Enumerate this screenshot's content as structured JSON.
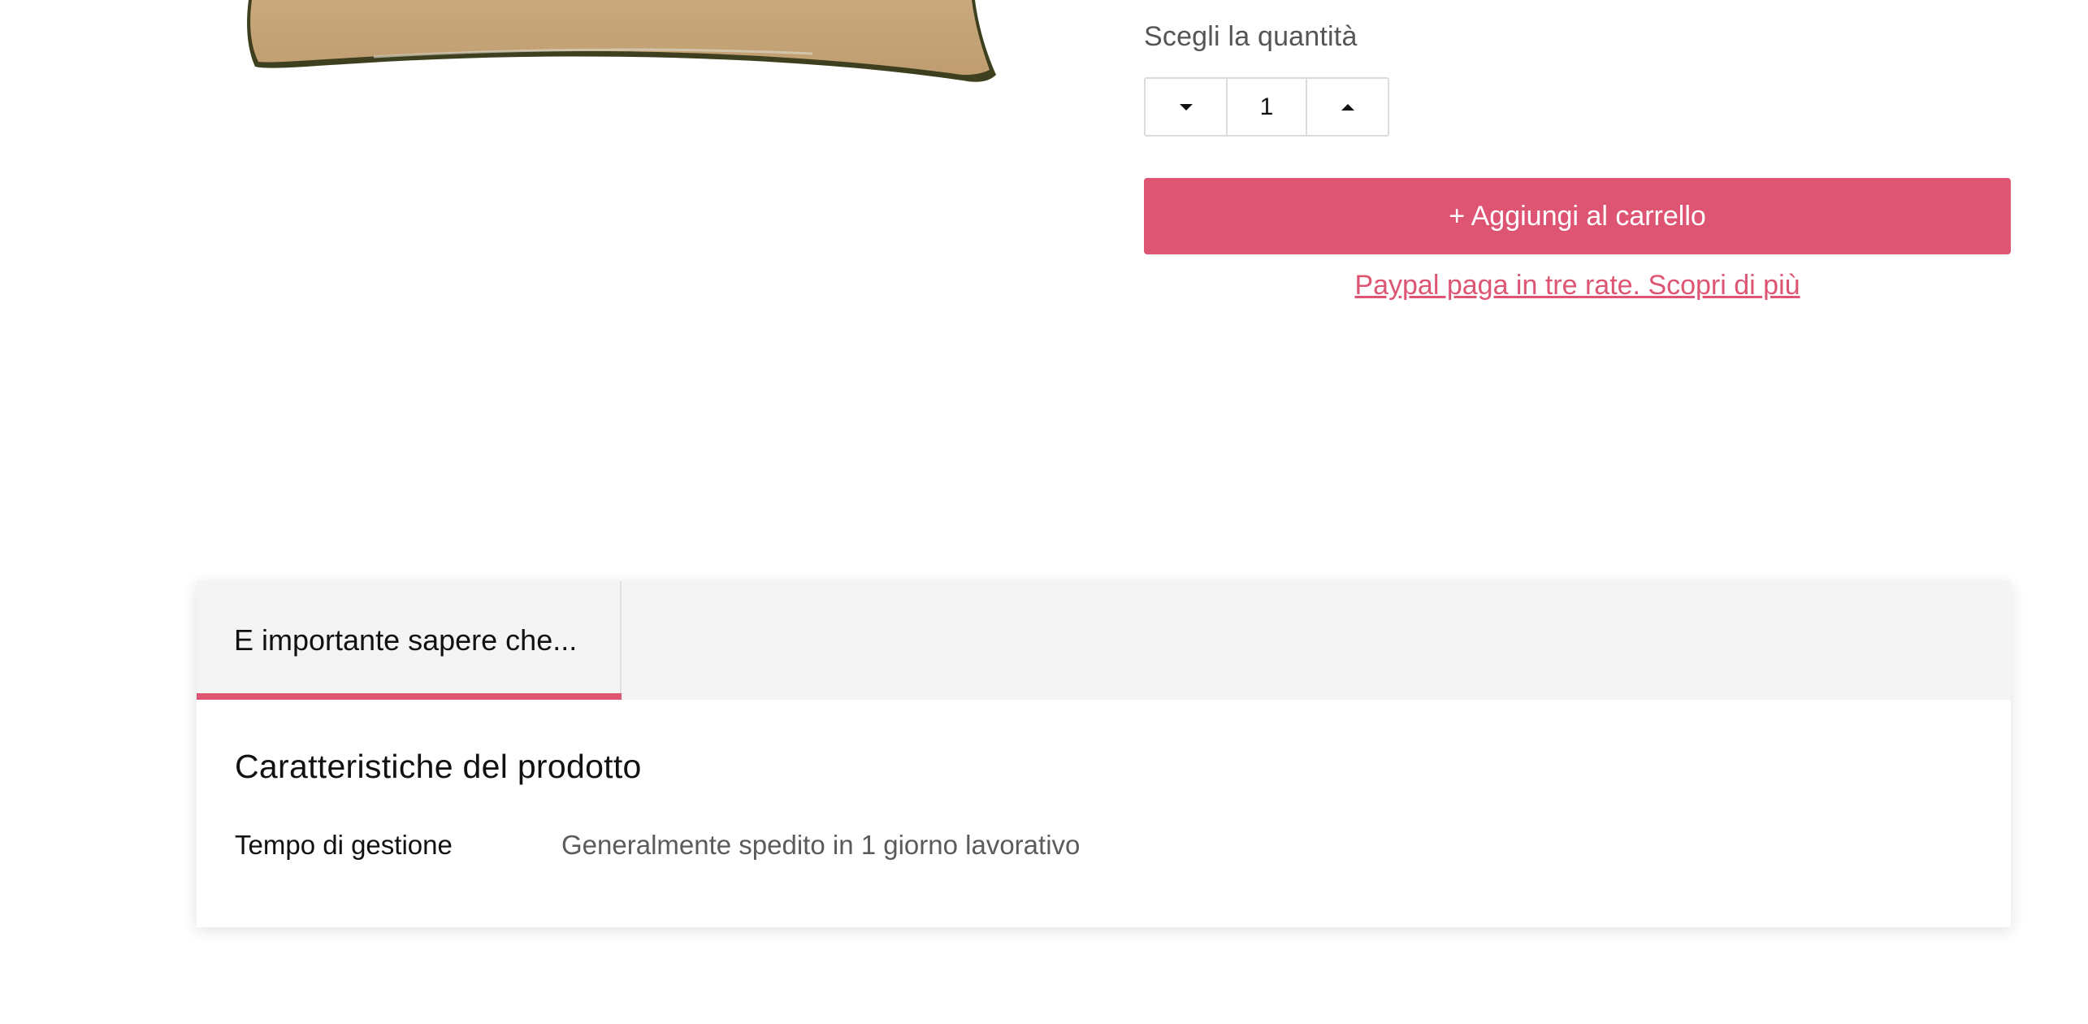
{
  "quantity": {
    "label": "Scegli la quantità",
    "value": "1"
  },
  "cart": {
    "add_label": "+ Aggiungi al carrello",
    "paypal_link": "Paypal paga in tre rate. Scopri di più"
  },
  "tabs": [
    {
      "label": "E importante sapere che..."
    }
  ],
  "details": {
    "title": "Caratteristiche del prodotto",
    "specs": [
      {
        "key": "Tempo di gestione",
        "value": "Generalmente spedito in 1 giorno lavorativo"
      }
    ]
  },
  "colors": {
    "accent": "#de5574",
    "tab_bar": "#f4f4f4",
    "pillow": "#c8a77a"
  },
  "icons": {
    "decrease": "caret-down-icon",
    "increase": "caret-up-icon"
  }
}
